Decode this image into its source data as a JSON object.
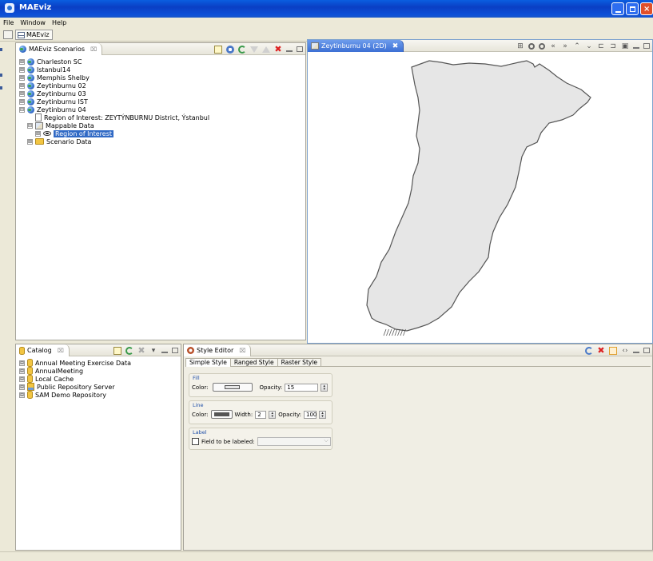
{
  "window": {
    "title": "MAEviz"
  },
  "menu": [
    "File",
    "Window",
    "Help"
  ],
  "perspective": {
    "label": "MAEviz"
  },
  "scenarios": {
    "tab_label": "MAEviz Scenarios",
    "close_glyph": "⌧",
    "items": [
      {
        "label": "Charleston SC"
      },
      {
        "label": "Istanbul14"
      },
      {
        "label": "Memphis Shelby"
      },
      {
        "label": "Zeytinburnu 02"
      },
      {
        "label": "Zeytinburnu 03"
      },
      {
        "label": "Zeytinburnu IST"
      },
      {
        "label": "Zeytinburnu 04"
      }
    ],
    "children": {
      "region": "Region of Interest: ZEYTÝNBURNU District, Ýstanbul",
      "mappable": "Mappable Data",
      "roi": "Region of Interest",
      "scenario_data": "Scenario Data"
    }
  },
  "map": {
    "tab_label": "Zeytinburnu 04 (2D)",
    "close_glyph": "✖",
    "fill_color": "#e6e6e6",
    "line_color": "#555555"
  },
  "catalog": {
    "tab_label": "Catalog",
    "close_glyph": "⌧",
    "items": [
      {
        "label": "Annual Meeting Exercise Data"
      },
      {
        "label": "AnnualMeeting"
      },
      {
        "label": "Local Cache"
      },
      {
        "label": "Public Repository Server"
      },
      {
        "label": "SAM Demo Repository"
      }
    ]
  },
  "style_editor": {
    "tab_label": "Style Editor",
    "close_glyph": "⌧",
    "tabs": [
      "Simple Style",
      "Ranged Style",
      "Raster Style"
    ],
    "fill": {
      "label": "Fill",
      "color_label": "Color:",
      "opacity_label": "Opacity:",
      "opacity": "15"
    },
    "line": {
      "label": "Line",
      "color_label": "Color:",
      "width_label": "Width:",
      "width": "2",
      "opacity_label": "Opacity:",
      "opacity": "100"
    },
    "label": {
      "label": "Label",
      "field_label": "Field to be labeled:"
    }
  },
  "icons": {
    "tree_expanded": "⊟",
    "tree_collapsed": "⊞"
  }
}
